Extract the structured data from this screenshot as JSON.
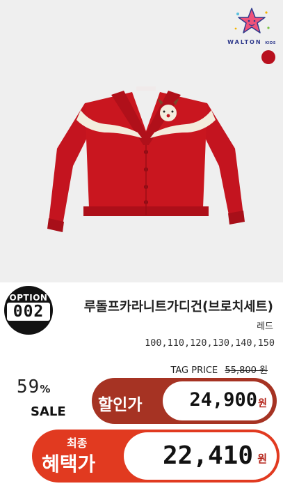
{
  "brand": {
    "logo_text": "WALTON",
    "logo_sub": "KIDS"
  },
  "colors": {
    "swatch": "#b8101e",
    "sale_pill": "#a63323",
    "final_pill": "#e13a20",
    "won": "#b5241a"
  },
  "option": {
    "label": "OPTION",
    "number": "002"
  },
  "product": {
    "name": "루돌프카라니트가디건(브로치세트)",
    "color": "레드",
    "sizes": "100,110,120,130,140,150"
  },
  "pricing": {
    "tag_label": "TAG PRICE",
    "tag_price": "55,800 원",
    "discount_rate": "59",
    "discount_unit": "%",
    "sale_word": "SALE",
    "sale_label": "할인가",
    "sale_price": "24,900",
    "sale_unit": "원",
    "final_label_top": "최종",
    "final_label": "혜택가",
    "final_price": "22,410",
    "final_unit": "원"
  }
}
